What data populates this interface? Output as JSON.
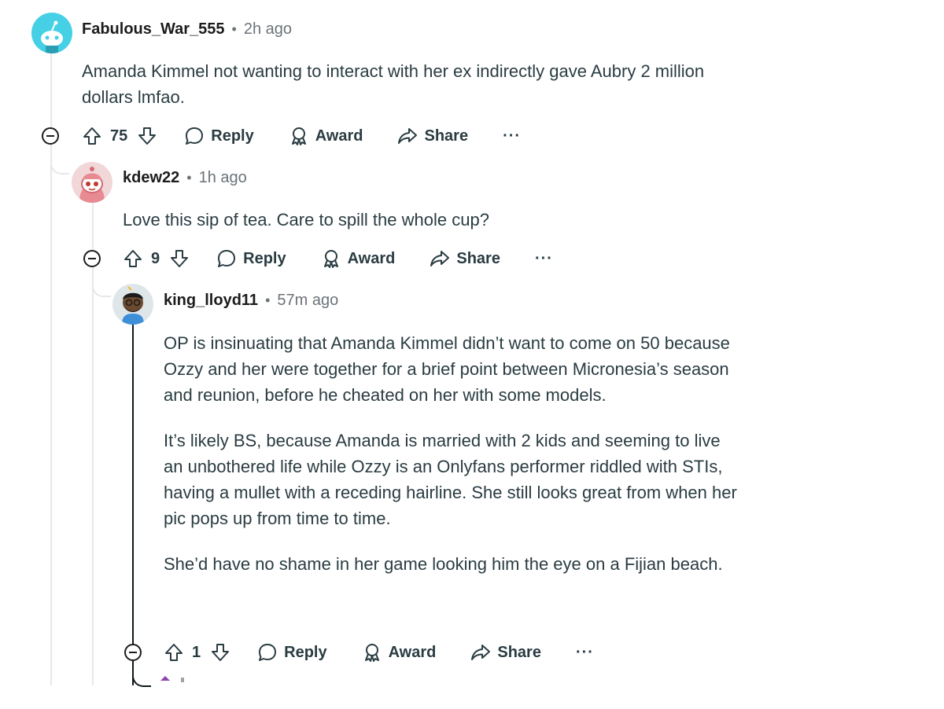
{
  "comments": [
    {
      "author": "Fabulous_War_555",
      "time": "2h ago",
      "paragraphs": [
        "Amanda Kimmel not wanting to interact with her ex indirectly gave Aubry 2 million dollars lmfao."
      ],
      "score": "75",
      "avatar_color": "#46d0e6"
    },
    {
      "author": "kdew22",
      "time": "1h ago",
      "paragraphs": [
        "Love this sip of tea. Care to spill the whole cup?"
      ],
      "score": "9",
      "avatar_color": "#f2d7d9"
    },
    {
      "author": "king_lloyd11",
      "time": "57m ago",
      "paragraphs": [
        "OP is insinuating that Amanda Kimmel didn’t want to come on 50 because Ozzy and her were together for a brief point between Micronesia’s season and reunion, before he cheated on her with some models.",
        "It’s likely BS, because Amanda is married with 2 kids and seeming to live an unbothered life while Ozzy is an Onlyfans performer riddled with STIs, having a mullet with a receding hairline. She still looks great from when her pic pops up from time to time.",
        "She’d have no shame in her game looking him the eye on a Fijian beach."
      ],
      "score": "1",
      "avatar_color": "#dfe6ea"
    }
  ],
  "actions": {
    "reply_label": "Reply",
    "award_label": "Award",
    "share_label": "Share",
    "more_label": "···"
  },
  "separator": "•"
}
